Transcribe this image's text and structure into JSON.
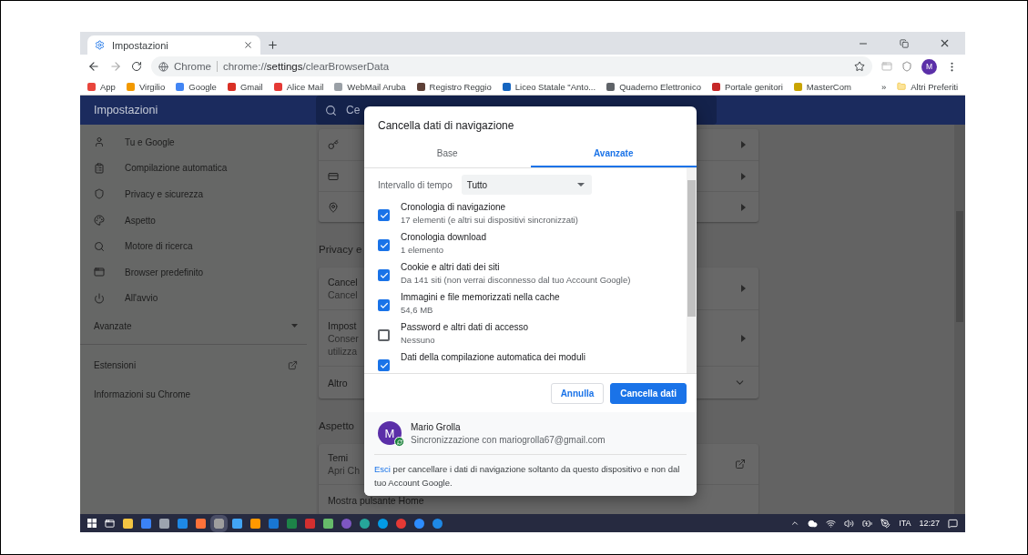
{
  "browser": {
    "tabs": [
      {
        "title": "Impostazioni",
        "selected": true
      }
    ],
    "address": {
      "chip": "Chrome",
      "url": "chrome://**settings**/clearBrowserData"
    },
    "profile_initial": "M",
    "bookmarks": [
      {
        "label": "App"
      },
      {
        "label": "Virgilio"
      },
      {
        "label": "Google"
      },
      {
        "label": "Gmail"
      },
      {
        "label": "Alice Mail"
      },
      {
        "label": "WebMail Aruba"
      },
      {
        "label": "Registro Reggio"
      },
      {
        "label": "Liceo Statale \"Anto..."
      },
      {
        "label": "Quaderno Elettronico"
      },
      {
        "label": "Portale genitori"
      },
      {
        "label": "MasterCom"
      }
    ],
    "bookmarks_overflow": "»",
    "other_bookmarks": "Altri Preferiti"
  },
  "settings": {
    "title": "Impostazioni",
    "search": {
      "placeholder": "Ce"
    },
    "sidebar": [
      {
        "label": "Tu e Google"
      },
      {
        "label": "Compilazione automatica"
      },
      {
        "label": "Privacy e sicurezza"
      },
      {
        "label": "Aspetto"
      },
      {
        "label": "Motore di ricerca"
      },
      {
        "label": "Browser predefinito"
      },
      {
        "label": "All'avvio"
      }
    ],
    "advanced": {
      "label": "Avanzate",
      "expanded": false
    },
    "extensions": "Estensioni",
    "about": "Informazioni su Chrome",
    "sections": [
      {
        "rows": [
          {
            "kind": "link"
          },
          {
            "kind": "link"
          },
          {
            "kind": "link"
          }
        ]
      },
      {
        "heading": "Privacy e",
        "rows": [
          {
            "lines": [
              "Cancel",
              "Cancel"
            ],
            "kind": "link"
          },
          {
            "lines": [
              "Impost",
              "Conser",
              "utilizza"
            ],
            "kind": "link"
          },
          {
            "lines": [
              "Altro"
            ],
            "kind": "expand"
          }
        ]
      },
      {
        "heading": "Aspetto",
        "rows": [
          {
            "lines": [
              "Temi",
              "Apri Ch"
            ],
            "kind": "external"
          },
          {
            "lines": [
              "Mostra pulsante Home"
            ],
            "kind": "plain"
          }
        ]
      }
    ]
  },
  "dialog": {
    "title": "Cancella dati di navigazione",
    "tabs": [
      {
        "label": "Base",
        "selected": false
      },
      {
        "label": "Avanzate",
        "selected": true
      }
    ],
    "time_range": {
      "label": "Intervallo di tempo",
      "value": "Tutto"
    },
    "items": [
      {
        "title": "Cronologia di navigazione",
        "detail": "17 elementi (e altri sui dispositivi sincronizzati)",
        "checked": true
      },
      {
        "title": "Cronologia download",
        "detail": "1 elemento",
        "checked": true
      },
      {
        "title": "Cookie e altri dati dei siti",
        "detail": "Da 141 siti (non verrai disconnesso dal tuo Account Google)",
        "checked": true
      },
      {
        "title": "Immagini e file memorizzati nella cache",
        "detail": "54,6 MB",
        "checked": true
      },
      {
        "title": "Password e altri dati di accesso",
        "detail": "Nessuno",
        "checked": false
      },
      {
        "title": "Dati della compilazione automatica dei moduli",
        "checked": true
      }
    ],
    "buttons": {
      "cancel": "Annulla",
      "confirm": "Cancella dati"
    },
    "account": {
      "initial": "M",
      "name": "Mario Grolla",
      "sync": "Sincronizzazione con mariogrolla67@gmail.com"
    },
    "footer": {
      "link": "Esci",
      "text": "per cancellare i dati di navigazione soltanto da questo dispositivo e non dal tuo Account Google."
    }
  },
  "taskbar": {
    "language": "ITA",
    "time": "12:27"
  }
}
